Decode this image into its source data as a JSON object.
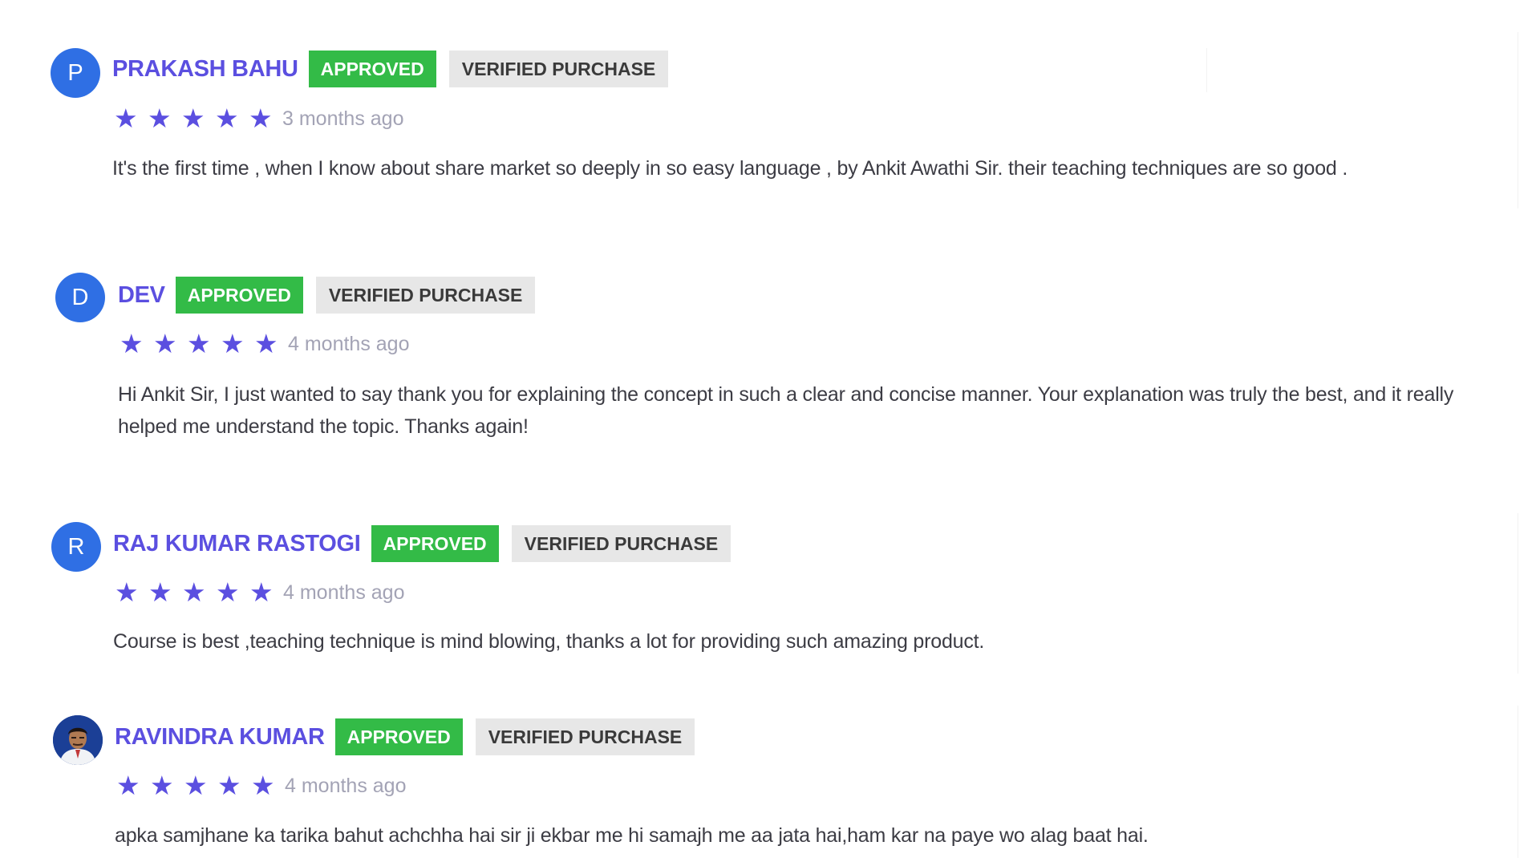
{
  "reviews": [
    {
      "avatar_letter": "P",
      "name": "PRAKASH BAHU",
      "status": "APPROVED",
      "purchase": "VERIFIED PURCHASE",
      "rating": 5,
      "time": "3 months ago",
      "comment": "It's the first time , when I know about share market so deeply in so easy language , by Ankit Awathi Sir. their teaching techniques are so good ."
    },
    {
      "avatar_letter": "D",
      "name": "DEV",
      "status": "APPROVED",
      "purchase": "VERIFIED PURCHASE",
      "rating": 5,
      "time": "4 months ago",
      "comment": "Hi Ankit Sir, I just wanted to say thank you for explaining the concept in such a clear and concise manner. Your explanation was truly the best, and it really helped me understand the topic. Thanks again!"
    },
    {
      "avatar_letter": "R",
      "name": "RAJ KUMAR RASTOGI",
      "status": "APPROVED",
      "purchase": "VERIFIED PURCHASE",
      "rating": 5,
      "time": "4 months ago",
      "comment": "Course is best ,teaching technique is mind blowing, thanks a lot for providing such amazing product."
    },
    {
      "avatar_letter": "",
      "avatar_icon": "user-photo",
      "name": "RAVINDRA KUMAR",
      "status": "APPROVED",
      "purchase": "VERIFIED PURCHASE",
      "rating": 5,
      "time": "4 months ago",
      "comment": "apka samjhane ka tarika bahut achchha hai sir ji ekbar me hi samajh me aa jata hai,ham kar na paye wo alag baat hai."
    }
  ],
  "colors": {
    "accent": "#5b4fe0",
    "avatar": "#2f6fe4",
    "approved": "#33bb47",
    "verified_bg": "#e7e7e7",
    "time_text": "#a3a3b5"
  },
  "icons": {
    "star": "star-icon",
    "photo": "user-photo-avatar"
  }
}
